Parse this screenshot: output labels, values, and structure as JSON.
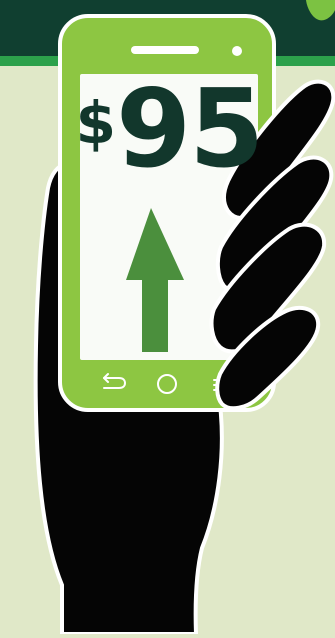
{
  "illustration": {
    "price": {
      "currency_symbol": "$",
      "amount": "95"
    },
    "icons": {
      "arrow": "arrow-up-icon",
      "back": "back-icon",
      "home": "home-icon",
      "menu": "menu-icon"
    },
    "colors": {
      "background": "#e0e8c8",
      "top_band": "#103f30",
      "green_band": "#2ca14b",
      "phone_body": "#8dc642",
      "screen": "#f9fbf7",
      "price_text": "#12372c",
      "arrow": "#4b8f3d",
      "hand": "#050505",
      "outline": "#ffffff"
    }
  }
}
